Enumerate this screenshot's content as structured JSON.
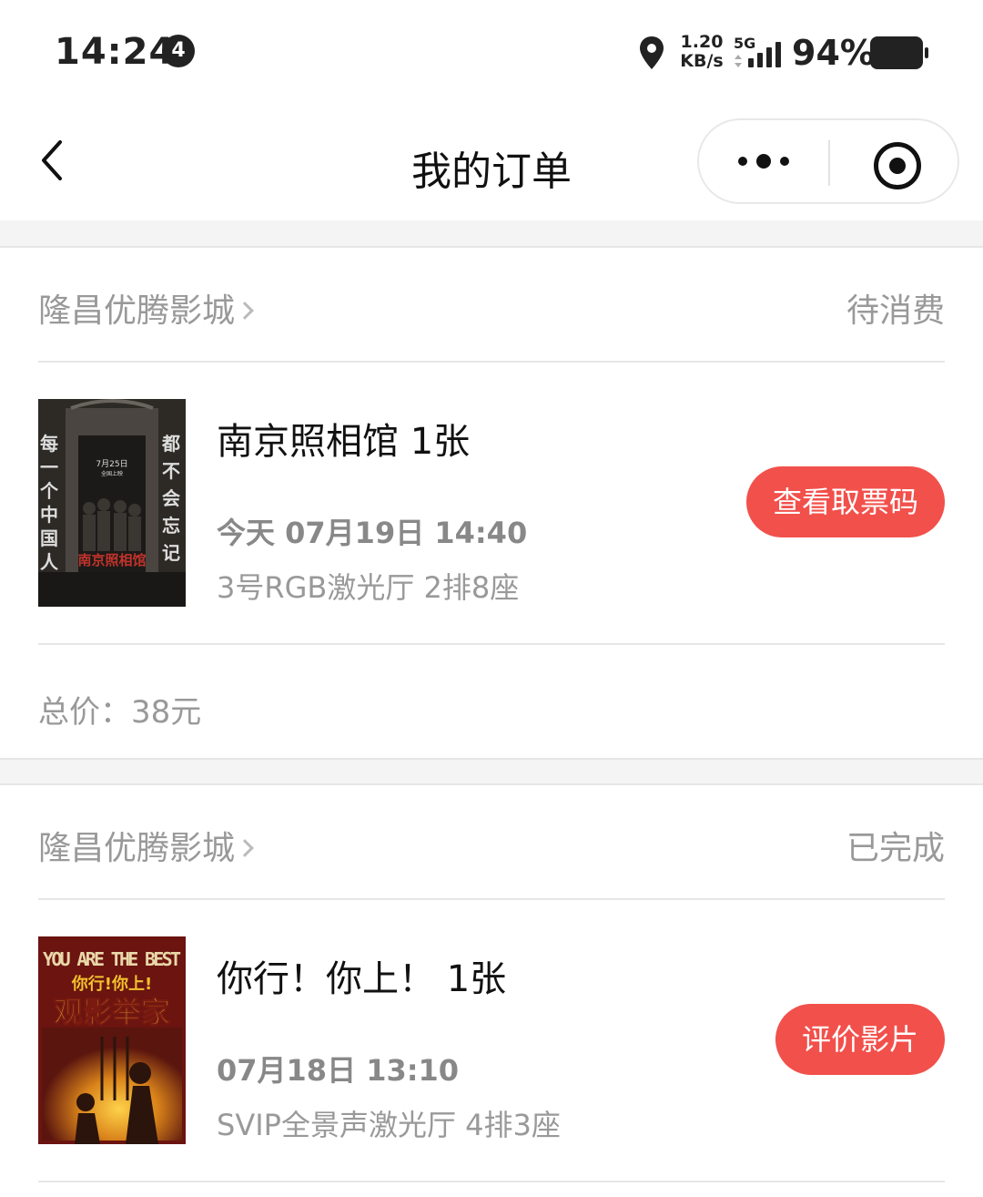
{
  "status_bar": {
    "time": "14:24",
    "notification_count": "4",
    "net_speed_value": "1.20",
    "net_speed_unit": "KB/s",
    "network": "5G",
    "battery_pct": "94%"
  },
  "navbar": {
    "title": "我的订单"
  },
  "orders": [
    {
      "cinema": "隆昌优腾影城",
      "status": "待消费",
      "movie": "南京照相馆 1张",
      "showtime": "今天 07月19日 14:40",
      "hall_seat": "3号RGB激光厅 2排8座",
      "action": "查看取票码",
      "total": "总价：38元",
      "poster": {
        "bg": "#2d2a26",
        "left_text": "每一个中国人",
        "right_text": "都不会忘记",
        "date": "7月25日",
        "sub": "全国上映",
        "title": "南京照相馆"
      }
    },
    {
      "cinema": "隆昌优腾影城",
      "status": "已完成",
      "movie": "你行！你上！ 1张",
      "showtime": "07月18日 13:10",
      "hall_seat": "SVIP全景声激光厅 4排3座",
      "action": "评价影片",
      "poster": {
        "bg": "#6b1410",
        "top_text": "YOU ARE THE BEST",
        "title": "你行!你上!",
        "sub": "观影举家"
      }
    }
  ],
  "colors": {
    "accent": "#f2504b",
    "muted_text": "#999999",
    "divider": "#e6e6e6"
  }
}
